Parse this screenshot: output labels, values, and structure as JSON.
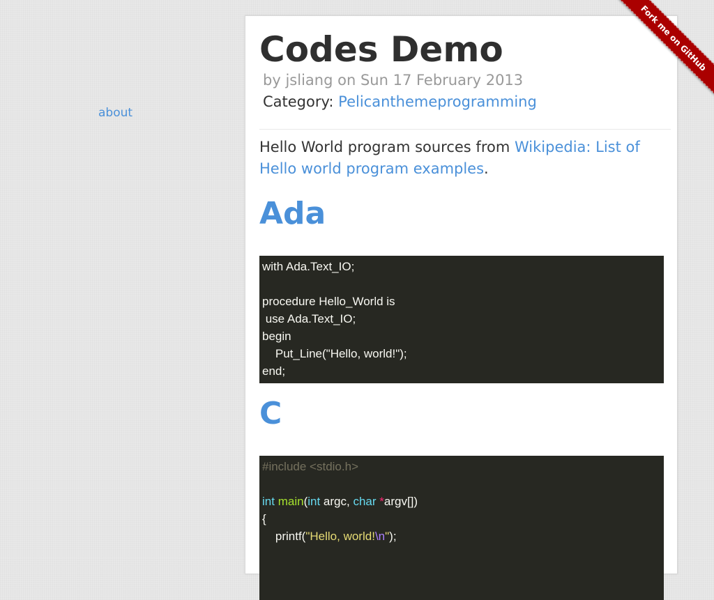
{
  "nav": {
    "about_label": "about"
  },
  "ribbon": {
    "label": "Fork me on GitHub",
    "color": "#aa0000"
  },
  "article": {
    "title": "Codes Demo",
    "byline": {
      "prefix": "by",
      "author": "jsliang",
      "on": "on",
      "date": "Sun 17 February 2013"
    },
    "category": {
      "label": "Category:",
      "value": "Pelicanthemeprogramming"
    },
    "intro": {
      "text": "Hello World program sources from ",
      "link": "Wikipedia: List of Hello world program examples",
      "end": "."
    },
    "sections": [
      {
        "heading": "Ada",
        "code": [
          "with Ada.Text_IO;",
          "",
          "procedure Hello_World is",
          " use Ada.Text_IO;",
          "begin",
          "    Put_Line(\"Hello, world!\");",
          "end;"
        ]
      },
      {
        "heading": "C",
        "code": {
          "l1": "#include <stdio.h>",
          "l3": {
            "int1": "int",
            "main": "main",
            "paren": "(",
            "int2": "int",
            "argc": " argc, ",
            "char": "char",
            "star": " *",
            "argv": "argv[])"
          },
          "l4": "{",
          "l5": {
            "printf": "    printf(",
            "str": "\"Hello, world!",
            "esc": "\\n",
            "quote": "\"",
            "end": ");"
          }
        }
      }
    ]
  },
  "colors": {
    "accent": "#4a90d9",
    "code_bg": "#272822"
  }
}
